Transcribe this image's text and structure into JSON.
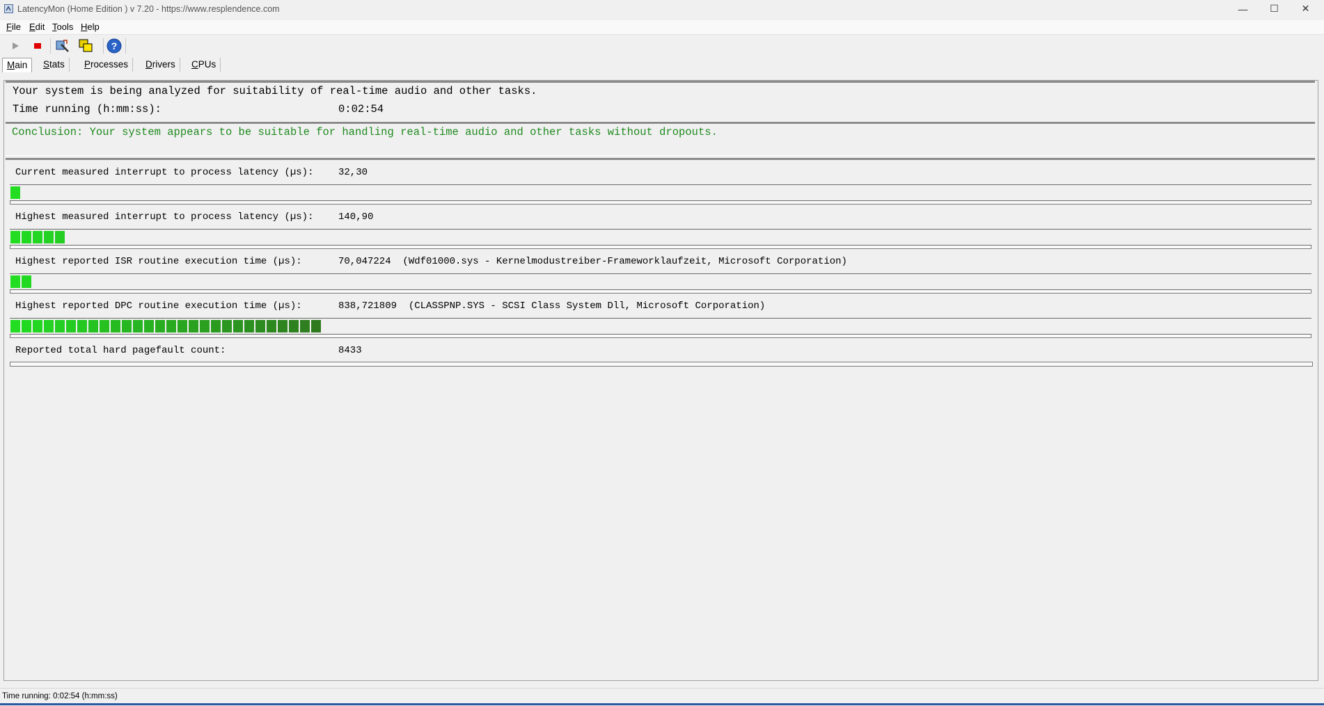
{
  "window": {
    "title": "LatencyMon  (Home Edition )  v 7.20 - https://www.resplendence.com",
    "minimize": "—",
    "maximize": "☐",
    "close": "✕"
  },
  "menu": {
    "file": "File",
    "edit": "Edit",
    "tools": "Tools",
    "help": "Help"
  },
  "toolbar": {
    "start_icon": "play-icon",
    "stop_icon": "stop-icon",
    "update_icon": "update-icon",
    "options_icon": "options-icon",
    "help_icon": "help-icon"
  },
  "tabs": [
    {
      "label": "Main",
      "active": true
    },
    {
      "label": "Stats"
    },
    {
      "label": "Processes"
    },
    {
      "label": "Drivers"
    },
    {
      "label": "CPUs"
    }
  ],
  "summary": {
    "analyzing": "Your system is being analyzed for suitability of real-time audio and other tasks.",
    "time_label": "Time running (h:mm:ss):",
    "time_value": "0:02:54",
    "conclusion": "Conclusion: Your system appears to be suitable for handling real-time audio and other tasks without dropouts."
  },
  "metrics": [
    {
      "label": "Current measured interrupt to process latency (µs):",
      "value": "32,30",
      "segments": 1
    },
    {
      "label": "Highest measured interrupt to process latency (µs):",
      "value": "140,90",
      "segments": 5
    },
    {
      "label": "Highest reported ISR routine execution time (µs):",
      "value": "70,047224  (Wdf01000.sys - Kernelmodustreiber-Frameworklaufzeit, Microsoft Corporation)",
      "segments": 2
    },
    {
      "label": "Highest reported DPC routine execution time (µs):",
      "value": "838,721809  (CLASSPNP.SYS - SCSI Class System Dll, Microsoft Corporation)",
      "segments": 28
    },
    {
      "label": "Reported total hard pagefault count:",
      "value": "8433"
    }
  ],
  "colors": {
    "bar_green": "#22dd22",
    "bar_dark_green": "#2f7a1f",
    "conclusion_green": "#1f8a1f"
  },
  "status": {
    "text": "Time running: 0:02:54  (h:mm:ss)"
  }
}
